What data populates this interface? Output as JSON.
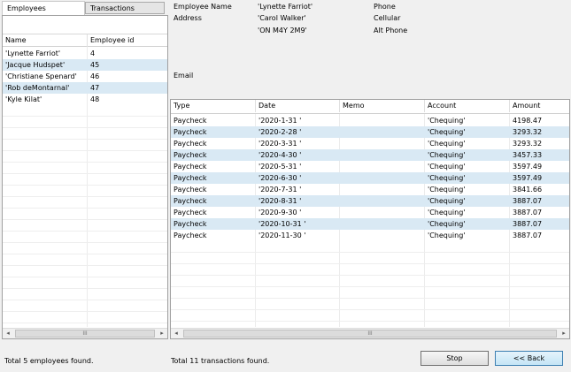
{
  "tabs": {
    "employees": "Employees",
    "transactions": "Transactions"
  },
  "employees": {
    "columns": [
      "Name",
      "Employee id"
    ],
    "rows": [
      {
        "name": "'Lynette Farriot'",
        "id": "4"
      },
      {
        "name": "'Jacque Hudspet'",
        "id": "45"
      },
      {
        "name": "'Christiane Spenard'",
        "id": "46"
      },
      {
        "name": "'Rob deMontarnal'",
        "id": "47"
      },
      {
        "name": "'Kyle Kilat'",
        "id": "48"
      }
    ]
  },
  "details": {
    "employee_name_label": "Employee Name",
    "employee_name_value": "'Lynette Farriot'",
    "address_label": "Address",
    "address_line1": "'Carol Walker'",
    "address_line2": "'ON M4Y 2M9'",
    "phone_label": "Phone",
    "cellular_label": "Cellular",
    "alt_phone_label": "Alt Phone",
    "email_label": "Email"
  },
  "transactions": {
    "columns": [
      "Type",
      "Date",
      "Memo",
      "Account",
      "Amount"
    ],
    "rows": [
      {
        "type": "Paycheck",
        "date": "'2020-1-31 '",
        "memo": "",
        "account": "'Chequing'",
        "amount": "4198.47"
      },
      {
        "type": "Paycheck",
        "date": "'2020-2-28 '",
        "memo": "",
        "account": "'Chequing'",
        "amount": "3293.32"
      },
      {
        "type": "Paycheck",
        "date": "'2020-3-31 '",
        "memo": "",
        "account": "'Chequing'",
        "amount": "3293.32"
      },
      {
        "type": "Paycheck",
        "date": "'2020-4-30 '",
        "memo": "",
        "account": "'Chequing'",
        "amount": "3457.33"
      },
      {
        "type": "Paycheck",
        "date": "'2020-5-31 '",
        "memo": "",
        "account": "'Chequing'",
        "amount": "3597.49"
      },
      {
        "type": "Paycheck",
        "date": "'2020-6-30 '",
        "memo": "",
        "account": "'Chequing'",
        "amount": "3597.49"
      },
      {
        "type": "Paycheck",
        "date": "'2020-7-31 '",
        "memo": "",
        "account": "'Chequing'",
        "amount": "3841.66"
      },
      {
        "type": "Paycheck",
        "date": "'2020-8-31 '",
        "memo": "",
        "account": "'Chequing'",
        "amount": "3887.07"
      },
      {
        "type": "Paycheck",
        "date": "'2020-9-30 '",
        "memo": "",
        "account": "'Chequing'",
        "amount": "3887.07"
      },
      {
        "type": "Paycheck",
        "date": "'2020-10-31 '",
        "memo": "",
        "account": "'Chequing'",
        "amount": "3887.07"
      },
      {
        "type": "Paycheck",
        "date": "'2020-11-30 '",
        "memo": "",
        "account": "'Chequing'",
        "amount": "3887.07"
      }
    ]
  },
  "status": {
    "employees_found": "Total 5 employees found.",
    "transactions_found": "Total 11 transactions found."
  },
  "buttons": {
    "stop": "Stop",
    "back": "<<  Back"
  },
  "scrollbar": {
    "left_arrow": "◂",
    "right_arrow": "▸",
    "grip": "III"
  },
  "colors": {
    "row_highlight": "#d9e9f4",
    "primary_button_border": "#3c7fb1"
  }
}
